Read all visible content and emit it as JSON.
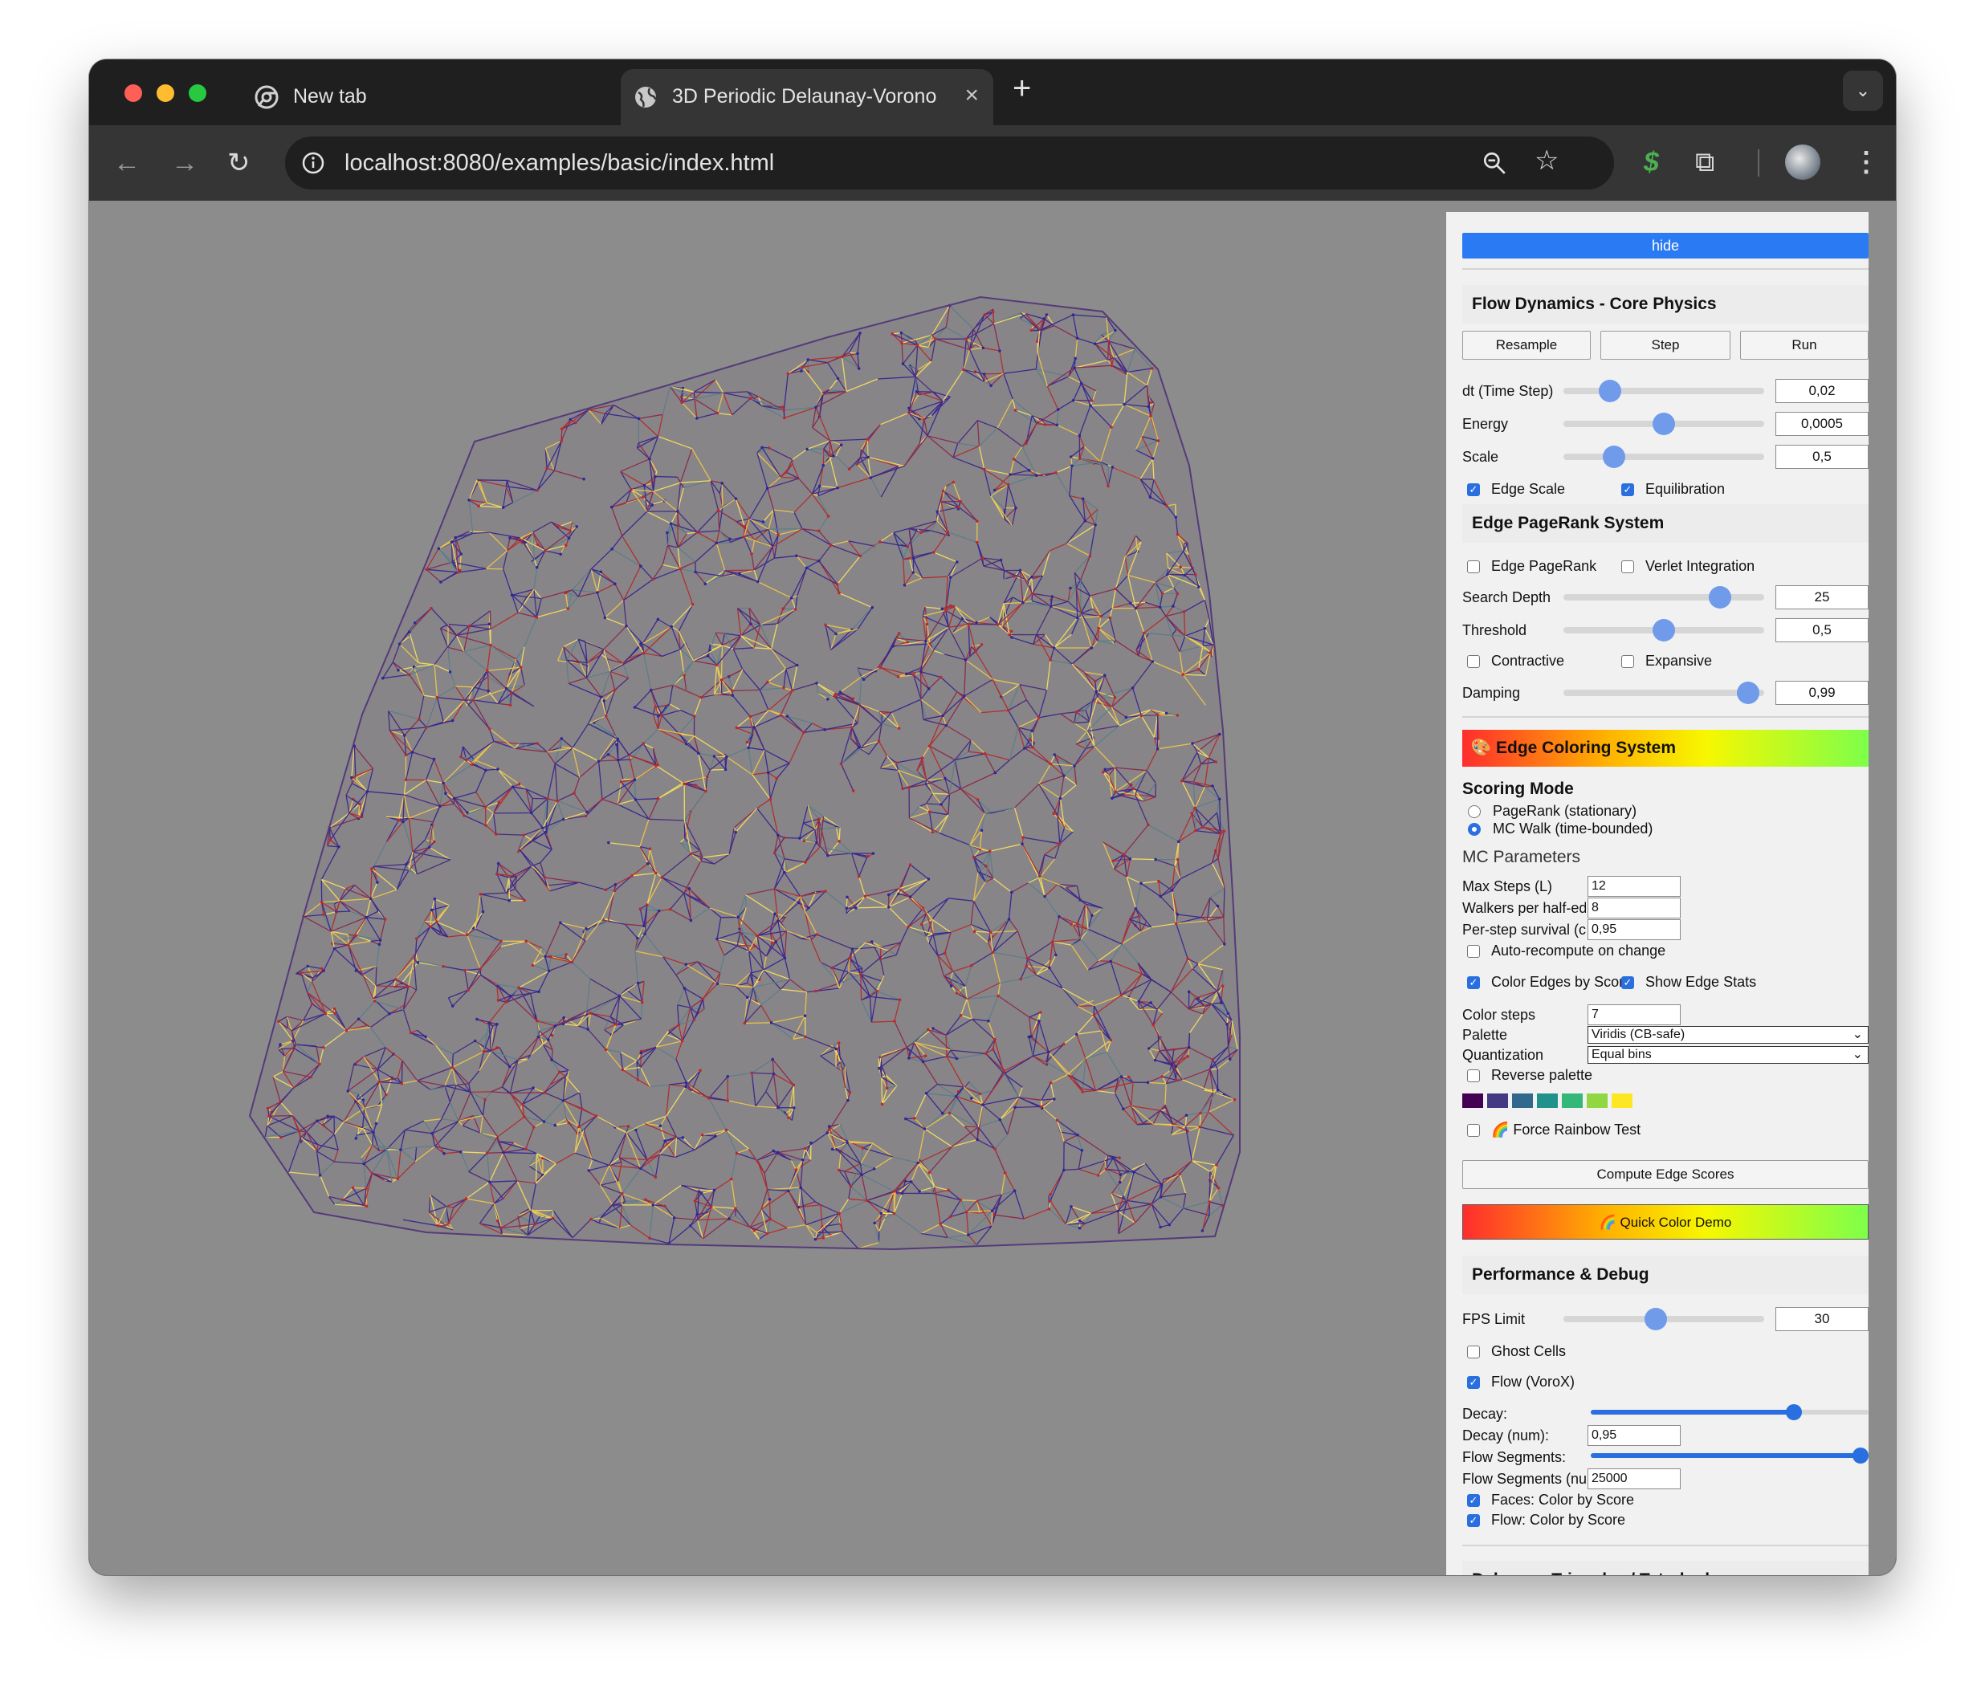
{
  "browser": {
    "tabs": [
      {
        "title": "New tab",
        "icon": "chrome-icon",
        "active": false
      },
      {
        "title": "3D Periodic Delaunay-Voronoi",
        "icon": "globe-icon",
        "active": true
      }
    ],
    "url": "localhost:8080/examples/basic/index.html",
    "tabmenu_icon": "chevron-down-icon"
  },
  "panel": {
    "hide_label": "hide",
    "flow": {
      "title": "Flow Dynamics - Core Physics",
      "resample": "Resample",
      "step": "Step",
      "run": "Run",
      "sliders": [
        {
          "label": "dt (Time Step)",
          "value": "0,02",
          "level": 0.23
        },
        {
          "label": "Energy",
          "value": "0,0005",
          "level": 0.5
        },
        {
          "label": "Scale",
          "value": "0,5",
          "level": 0.25
        }
      ],
      "edge_scale": "Edge Scale",
      "equilibration": "Equilibration"
    },
    "pagerank": {
      "title": "Edge PageRank System",
      "edge_pagerank": "Edge PageRank",
      "verlet": "Verlet Integration",
      "search_depth": {
        "label": "Search Depth",
        "value": "25",
        "level": 0.78
      },
      "threshold": {
        "label": "Threshold",
        "value": "0,5",
        "level": 0.5
      },
      "contractive": "Contractive",
      "expansive": "Expansive",
      "damping": {
        "label": "Damping",
        "value": "0,99",
        "level": 0.92
      }
    },
    "coloring": {
      "title": "🎨 Edge Coloring System",
      "scoring_mode": "Scoring Mode",
      "mode_pagerank": "PageRank (stationary)",
      "mode_mc": "MC Walk (time-bounded)",
      "mc_params": "MC Parameters",
      "max_steps_label": "Max Steps (L)",
      "max_steps_value": "12",
      "walkers_label": "Walkers per half-edge",
      "walkers_value": "8",
      "survival_label": "Per-step survival (c)",
      "survival_value": "0,95",
      "auto_recompute": "Auto-recompute on change",
      "color_edges": "Color Edges by Score",
      "show_stats": "Show Edge Stats",
      "color_steps_label": "Color steps",
      "color_steps_value": "7",
      "palette_label": "Palette",
      "palette_value": "Viridis (CB-safe)",
      "quant_label": "Quantization",
      "quant_value": "Equal bins",
      "reverse": "Reverse palette",
      "swatches": [
        "#440154",
        "#443983",
        "#31688e",
        "#21918c",
        "#35b779",
        "#90d743",
        "#fde725"
      ],
      "force_rainbow": "🌈 Force Rainbow Test",
      "compute": "Compute Edge Scores",
      "quick_demo": "🌈 Quick Color Demo"
    },
    "perf": {
      "title": "Performance & Debug",
      "fps": {
        "label": "FPS Limit",
        "value": "30",
        "level": 0.46
      },
      "ghost": "Ghost Cells",
      "flow": "Flow (VoroX)",
      "decay_label": "Decay:",
      "decay_level": 0.73,
      "decay_num_label": "Decay (num):",
      "decay_num_value": "0,95",
      "segments_label": "Flow Segments:",
      "segments_level": 0.97,
      "segments_num_label": "Flow Segments (num):",
      "segments_num_value": "25000",
      "faces_color": "Faces: Color by Score",
      "flow_color": "Flow: Color by Score"
    },
    "delaunay_title": "Delaunay Triangles / Tetrahedra"
  }
}
